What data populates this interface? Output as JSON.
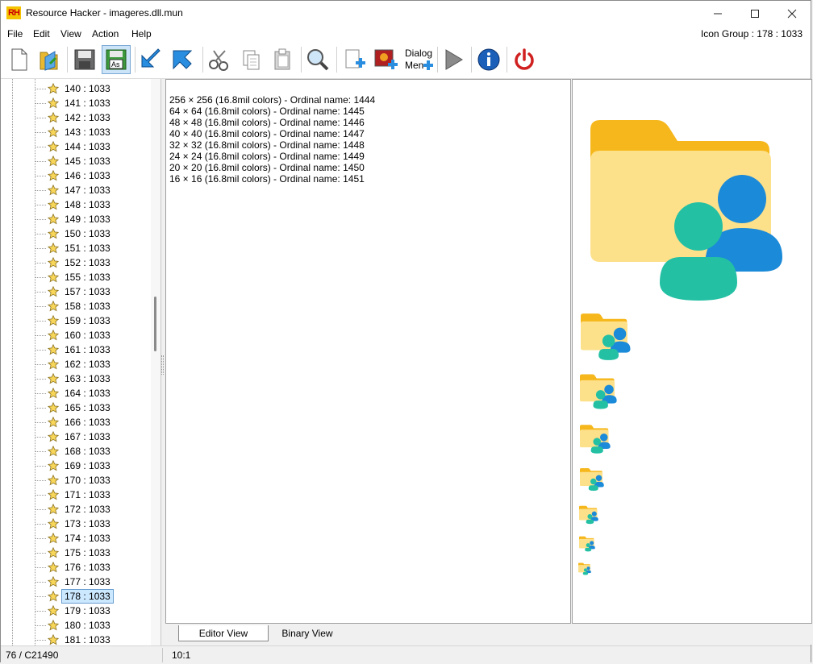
{
  "window": {
    "title": "Resource Hacker - imageres.dll.mun",
    "app_icon_text": "RH",
    "controls": {
      "minimize": "—",
      "maximize": "☐",
      "close": "✕"
    }
  },
  "menu": {
    "items": [
      "File",
      "Edit",
      "View",
      "Action",
      "Help"
    ],
    "status": "Icon Group : 178 : 1033"
  },
  "toolbar": {
    "dialog_menu_label_line1": "Dialog",
    "dialog_menu_label_line2": "Men"
  },
  "tree": {
    "items": [
      "140 : 1033",
      "141 : 1033",
      "142 : 1033",
      "143 : 1033",
      "144 : 1033",
      "145 : 1033",
      "146 : 1033",
      "147 : 1033",
      "148 : 1033",
      "149 : 1033",
      "150 : 1033",
      "151 : 1033",
      "152 : 1033",
      "155 : 1033",
      "157 : 1033",
      "158 : 1033",
      "159 : 1033",
      "160 : 1033",
      "161 : 1033",
      "162 : 1033",
      "163 : 1033",
      "164 : 1033",
      "165 : 1033",
      "166 : 1033",
      "167 : 1033",
      "168 : 1033",
      "169 : 1033",
      "170 : 1033",
      "171 : 1033",
      "172 : 1033",
      "173 : 1033",
      "174 : 1033",
      "175 : 1033",
      "176 : 1033",
      "177 : 1033",
      "178 : 1033",
      "179 : 1033",
      "180 : 1033",
      "181 : 1033"
    ],
    "selected": "178 : 1033"
  },
  "editor": {
    "lines": [
      "256 × 256 (16.8mil colors) - Ordinal name: 1444",
      "64 × 64 (16.8mil colors) - Ordinal name: 1445",
      "48 × 48 (16.8mil colors) - Ordinal name: 1446",
      "40 × 40 (16.8mil colors) - Ordinal name: 1447",
      "32 × 32 (16.8mil colors) - Ordinal name: 1448",
      "24 × 24 (16.8mil colors) - Ordinal name: 1449",
      "20 × 20 (16.8mil colors) - Ordinal name: 1450",
      "16 × 16 (16.8mil colors) - Ordinal name: 1451"
    ]
  },
  "preview": {
    "icon_sizes": [
      256,
      64,
      48,
      40,
      32,
      24,
      20,
      16
    ],
    "icon_name": "folder-users-icon"
  },
  "tabs": {
    "editor_view": "Editor View",
    "binary_view": "Binary View"
  },
  "status": {
    "left": "76 / C21490",
    "cursor": "10:1"
  },
  "colors": {
    "folder_back": "#f6b71c",
    "folder_front": "#fde08a",
    "user_teal": "#23c0a4",
    "user_blue": "#1b8ad8",
    "selection": "#cce8ff"
  }
}
